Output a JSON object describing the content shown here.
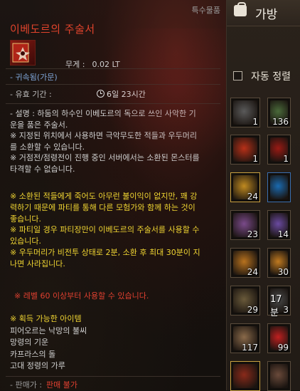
{
  "tooltip": {
    "category": "특수물품",
    "title": "이베도르의 주술서",
    "icon": "spellbook-icon",
    "weight_label": "무게 :",
    "weight_value": "0.02 LT",
    "bound": "- 귀속됨(가문)",
    "expire_label": "- 유효 기간 :",
    "expire_value": "6일 23시간",
    "description": [
      "- 설명 : 하둠의 하수인 이베도르의 독으로 쓰인 사악한 기",
      "운을 품은 주술서.",
      "※ 지정된 위치에서 사용하면 극악무도한 적들과 우두머리",
      "를 소환할 수 있습니다.",
      "※ 거점전/점령전이 진행 중인 서버에서는 소환된 몬스터를",
      "타격할 수 없습니다."
    ],
    "warnings": [
      "※ 소환된 적들에게 죽어도 아무런 불이익이 없지만, 꽤 강",
      "력하기 때문에 파티를 통해 다른 모험가와 함께 하는 것이",
      "좋습니다.",
      "※ 파티일 경우 파티장만이 이베도르의 주술서를 사용할 수",
      "있습니다.",
      "※ 우두머리가 비전투 상태로 2분, 소환 후 최대 30분이 지",
      "나면 사라집니다."
    ],
    "requirement": "※ 레벨 60 이상부터 사용할 수 있습니다.",
    "obtain_heading": "※ 획득 가능한 아이템",
    "obtain_items": [
      "피어오르는 낙망의 불씨",
      "망령의 기운",
      "카프라스의 돌",
      "고대 정령의 가루"
    ],
    "price_label": "- 판매가 :",
    "price_value": "판매 불가"
  },
  "bag": {
    "title": "가방",
    "icon": "bag-icon",
    "sort_label": "자동 정렬",
    "slots": [
      {
        "icon": "medal-icon",
        "qty": "1",
        "color": "#5a5a5a"
      },
      {
        "icon": "ore-icon",
        "qty": "136",
        "color": "#4a6a3a"
      },
      {
        "icon": "fire-scroll-icon",
        "qty": "1",
        "color": "#b83018"
      },
      {
        "icon": "spellbook-icon",
        "qty": "1",
        "color": "#9a1a14"
      },
      {
        "icon": "gold-relic-icon",
        "qty": "24",
        "color": "#c08a20"
      },
      {
        "icon": "blue-crystal-icon",
        "qty": "",
        "color": "#1a6ab0"
      },
      {
        "icon": "purple-potion-icon",
        "qty": "23",
        "color": "#7a4a8a"
      },
      {
        "icon": "purple-potion-icon",
        "qty": "14",
        "color": "#6a4aa0"
      },
      {
        "icon": "orange-elixir-icon",
        "qty": "24",
        "color": "#b8721e"
      },
      {
        "icon": "orange-elixir-icon",
        "qty": "30",
        "color": "#c07a20"
      },
      {
        "icon": "food-plate-icon",
        "qty": "29",
        "color": "#6a5a3a"
      },
      {
        "icon": "food-dish-icon",
        "qty": "3",
        "timer": "17분",
        "color": "#4a4a4a"
      },
      {
        "icon": "drink-cup-icon",
        "qty": "117",
        "color": "#8a6a4a"
      },
      {
        "icon": "red-potion-icon",
        "qty": "99",
        "color": "#c02020"
      },
      {
        "icon": "treasure-chest-icon",
        "qty": "",
        "color": "#8a2a1a"
      },
      {
        "icon": "sword-icon",
        "qty": "",
        "color": "#6a4a3a"
      }
    ]
  }
}
